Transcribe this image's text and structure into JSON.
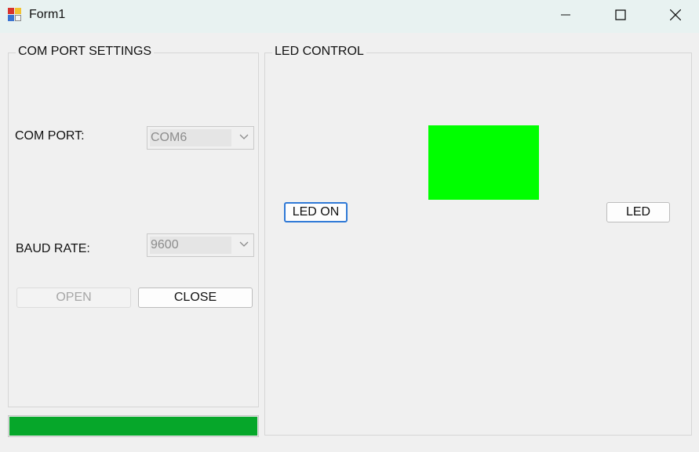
{
  "window": {
    "title": "Form1",
    "icons": [
      "app-icon",
      "minimize-icon",
      "maximize-icon",
      "close-icon"
    ]
  },
  "com_settings": {
    "group_title": "COM PORT SETTINGS",
    "com_port_label": "COM PORT:",
    "com_port_value": "COM6",
    "baud_rate_label": "BAUD RATE:",
    "baud_rate_value": "9600",
    "open_label": "OPEN",
    "close_label": "CLOSE"
  },
  "led_control": {
    "group_title": "LED CONTROL",
    "led_on_label": "LED ON",
    "led_label": "LED",
    "indicator_color": "#00ff00"
  },
  "progress": {
    "value_percent": 100,
    "color": "#06a72a"
  }
}
